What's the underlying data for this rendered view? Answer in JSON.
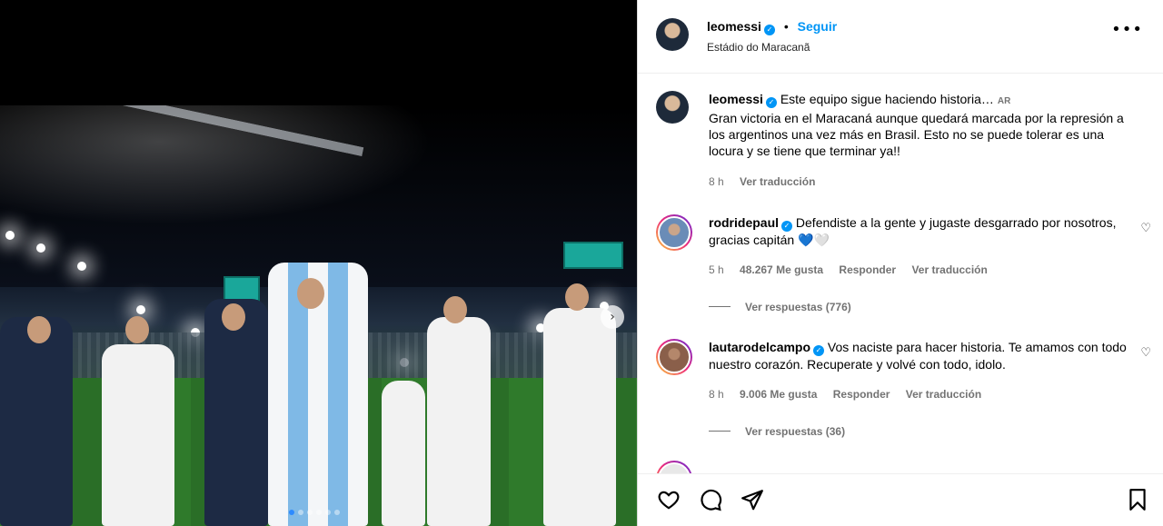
{
  "header": {
    "username": "leomessi",
    "separator": "•",
    "follow_label": "Seguir",
    "location": "Estádio do Maracanã",
    "more_icon": "more-horizontal-icon"
  },
  "caption": {
    "username": "leomessi",
    "first_line": "Este equipo sigue haciendo historia…",
    "lang_badge": "AR",
    "body": "Gran victoria en el Maracaná aunque quedará marcada por la represión a los argentinos una vez más en Brasil. Esto no se puede tolerar es una locura y se tiene que terminar ya!!",
    "time": "8 h",
    "translate": "Ver traducción"
  },
  "comments": [
    {
      "username": "rodridepaul",
      "text": "Defendiste a la gente y jugaste desgarrado por nosotros, gracias capitán 💙🤍",
      "time": "5 h",
      "likes": "48.267 Me gusta",
      "reply": "Responder",
      "translate": "Ver traducción",
      "replies": "Ver respuestas (776)"
    },
    {
      "username": "lautarodelcampo",
      "text": "Vos naciste para hacer historia. Te amamos con todo nuestro corazón. Recuperate y volvé con todo, idolo.",
      "time": "8 h",
      "likes": "9.006 Me gusta",
      "reply": "Responder",
      "translate": "Ver traducción",
      "replies": "Ver respuestas (36)"
    }
  ],
  "carousel": {
    "count": 6,
    "active_index": 0
  },
  "colors": {
    "link": "#0095f6",
    "muted": "#737373",
    "verified": "#0095f6"
  },
  "icons": [
    "heart-icon",
    "comment-icon",
    "share-icon",
    "bookmark-icon",
    "chevron-right-icon",
    "verified-badge-icon"
  ]
}
